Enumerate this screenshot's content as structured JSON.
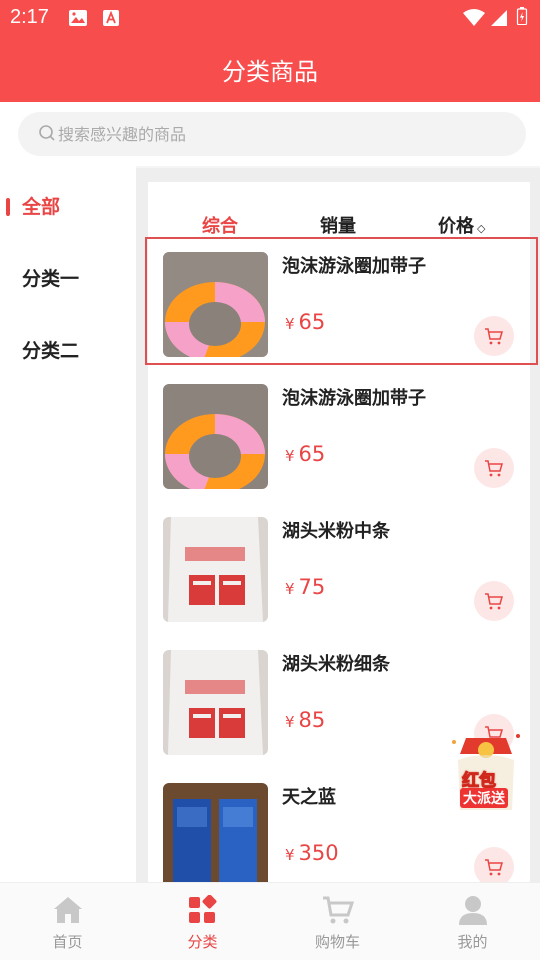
{
  "status_bar": {
    "time": "2:17"
  },
  "header": {
    "title": "分类商品"
  },
  "search": {
    "placeholder": "搜索感兴趣的商品"
  },
  "sidebar": {
    "items": [
      {
        "label": "全部",
        "active": true
      },
      {
        "label": "分类一",
        "active": false
      },
      {
        "label": "分类二",
        "active": false
      }
    ]
  },
  "sort": {
    "comprehensive": "综合",
    "sales": "销量",
    "price": "价格",
    "price_caret": "◇"
  },
  "currency": "¥",
  "products": [
    {
      "name": "泡沫游泳圈加带子",
      "price": "65",
      "thumb": "swim-ring"
    },
    {
      "name": "泡沫游泳圈加带子",
      "price": "65",
      "thumb": "swim-ring"
    },
    {
      "name": "湖头米粉中条",
      "price": "75",
      "thumb": "rice-noodle-bag"
    },
    {
      "name": "湖头米粉细条",
      "price": "85",
      "thumb": "rice-noodle-bag"
    },
    {
      "name": "天之蓝",
      "price": "350",
      "thumb": "liquor-box"
    }
  ],
  "red_packet": {
    "line1": "红包",
    "line2": "大派送"
  },
  "tabbar": {
    "items": [
      {
        "label": "首页",
        "icon": "home-icon"
      },
      {
        "label": "分类",
        "icon": "category-icon",
        "active": true
      },
      {
        "label": "购物车",
        "icon": "cart-icon"
      },
      {
        "label": "我的",
        "icon": "user-icon"
      }
    ]
  },
  "colors": {
    "brand_red": "#f74d4d",
    "accent": "#e94545"
  }
}
